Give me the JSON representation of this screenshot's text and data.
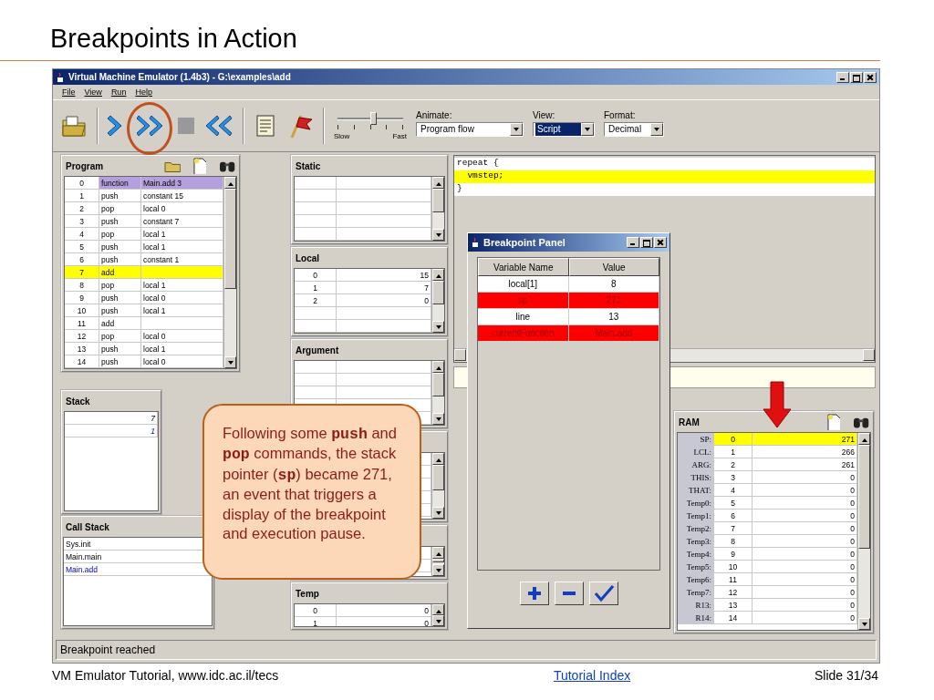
{
  "slide": {
    "title": "Breakpoints in Action",
    "footer_left": "VM Emulator Tutorial, www.idc.ac.il/tecs",
    "footer_link": "Tutorial Index",
    "footer_right": "Slide 31/34"
  },
  "window": {
    "title": "Virtual Machine Emulator (1.4b3) - G:\\examples\\add"
  },
  "menu": [
    "File",
    "View",
    "Run",
    "Help"
  ],
  "toolbar": {
    "slider": {
      "level": 0.55,
      "low_label": "Slow",
      "high_label": "Fast"
    },
    "dropdowns": [
      {
        "label": "Animate:",
        "value": "Program flow",
        "selected": false
      },
      {
        "label": "View:",
        "value": "Script",
        "selected": true
      },
      {
        "label": "Format:",
        "value": "Decimal",
        "selected": false
      }
    ]
  },
  "program": {
    "title": "Program",
    "rows": [
      {
        "index": "0",
        "command": "function",
        "argument": "Main.add 3",
        "selected": false,
        "highlighted": true
      },
      {
        "index": "1",
        "command": "push",
        "argument": "constant 15",
        "selected": false,
        "highlighted": false
      },
      {
        "index": "2",
        "command": "pop",
        "argument": "local 0",
        "selected": false,
        "highlighted": false
      },
      {
        "index": "3",
        "command": "push",
        "argument": "constant 7",
        "selected": false,
        "highlighted": false
      },
      {
        "index": "4",
        "command": "pop",
        "argument": "local 1",
        "selected": false,
        "highlighted": false
      },
      {
        "index": "5",
        "command": "push",
        "argument": "local 1",
        "selected": false,
        "highlighted": false
      },
      {
        "index": "6",
        "command": "push",
        "argument": "constant 1",
        "selected": false,
        "highlighted": false
      },
      {
        "index": "7",
        "command": "add",
        "argument": "",
        "selected": true,
        "highlighted": false
      },
      {
        "index": "8",
        "command": "pop",
        "argument": "local 1",
        "selected": false,
        "highlighted": false
      },
      {
        "index": "9",
        "command": "push",
        "argument": "local 0",
        "selected": false,
        "highlighted": false
      },
      {
        "index": "10",
        "command": "push",
        "argument": "local 1",
        "selected": false,
        "highlighted": false
      },
      {
        "index": "11",
        "command": "add",
        "argument": "",
        "selected": false,
        "highlighted": false
      },
      {
        "index": "12",
        "command": "pop",
        "argument": "local 0",
        "selected": false,
        "highlighted": false
      },
      {
        "index": "13",
        "command": "push",
        "argument": "local 1",
        "selected": false,
        "highlighted": false
      },
      {
        "index": "14",
        "command": "push",
        "argument": "local 0",
        "selected": false,
        "highlighted": false
      }
    ]
  },
  "stack": {
    "title": "Stack",
    "values": [
      {
        "value": "7",
        "top": false
      },
      {
        "value": "1",
        "top": true
      }
    ]
  },
  "call_stack": {
    "title": "Call Stack",
    "items": [
      {
        "name": "Sys.init",
        "current": false
      },
      {
        "name": "Main.main",
        "current": false
      },
      {
        "name": "Main.add",
        "current": true
      }
    ]
  },
  "static": {
    "title": "Static"
  },
  "local": {
    "title": "Local",
    "rows": [
      {
        "index": "0",
        "value": "15"
      },
      {
        "index": "1",
        "value": "7"
      },
      {
        "index": "2",
        "value": "0"
      }
    ]
  },
  "argument": {
    "title": "Argument"
  },
  "temp": {
    "title": "Temp",
    "rows": [
      {
        "index": "0",
        "value": "0"
      },
      {
        "index": "1",
        "value": "0"
      }
    ]
  },
  "script": {
    "lines": [
      {
        "text": "repeat {",
        "selected": false
      },
      {
        "text": "  vmstep;",
        "selected": true
      },
      {
        "text": "}",
        "selected": false
      }
    ]
  },
  "ram": {
    "title": "RAM",
    "rows": [
      {
        "label": "SP:",
        "address": "0",
        "value": "271",
        "selected": true
      },
      {
        "label": "LCL:",
        "address": "1",
        "value": "266",
        "selected": false
      },
      {
        "label": "ARG:",
        "address": "2",
        "value": "261",
        "selected": false
      },
      {
        "label": "THIS:",
        "address": "3",
        "value": "0",
        "selected": false
      },
      {
        "label": "THAT:",
        "address": "4",
        "value": "0",
        "selected": false
      },
      {
        "label": "Temp0:",
        "address": "5",
        "value": "0",
        "selected": false
      },
      {
        "label": "Temp1:",
        "address": "6",
        "value": "0",
        "selected": false
      },
      {
        "label": "Temp2:",
        "address": "7",
        "value": "0",
        "selected": false
      },
      {
        "label": "Temp3:",
        "address": "8",
        "value": "0",
        "selected": false
      },
      {
        "label": "Temp4:",
        "address": "9",
        "value": "0",
        "selected": false
      },
      {
        "label": "Temp5:",
        "address": "10",
        "value": "0",
        "selected": false
      },
      {
        "label": "Temp6:",
        "address": "11",
        "value": "0",
        "selected": false
      },
      {
        "label": "Temp7:",
        "address": "12",
        "value": "0",
        "selected": false
      },
      {
        "label": "R13:",
        "address": "13",
        "value": "0",
        "selected": false
      },
      {
        "label": "R14:",
        "address": "14",
        "value": "0",
        "selected": false
      }
    ]
  },
  "breakpoint_panel": {
    "title": "Breakpoint Panel",
    "columns": [
      "Variable Name",
      "Value"
    ],
    "rows": [
      {
        "name": "local[1]",
        "value": "8",
        "triggered": false
      },
      {
        "name": "sp",
        "value": "271",
        "triggered": true
      },
      {
        "name": "line",
        "value": "13",
        "triggered": false
      },
      {
        "name": "currentFunction",
        "value": "Main.add",
        "triggered": true
      }
    ]
  },
  "callout": {
    "text": "Following some **push** and **pop** commands, the stack pointer (**sp**) became 271, an event that triggers a display of the breakpoint and execution pause."
  },
  "status_bar": "Breakpoint reached"
}
